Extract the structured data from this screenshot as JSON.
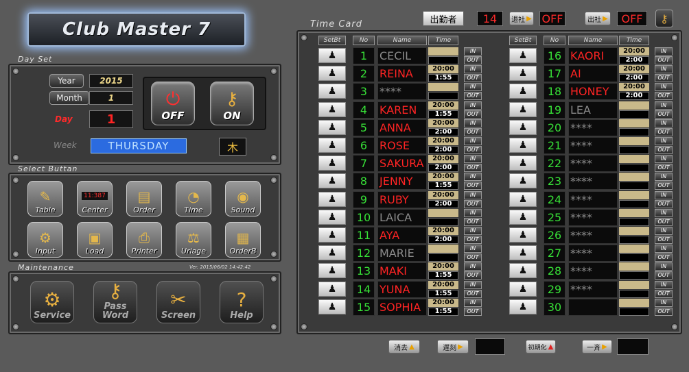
{
  "app": {
    "title": "Club Master 7",
    "version": "Ver. 2015/06/02 14:42:42"
  },
  "sections": {
    "day_set": "Day Set",
    "select_button": "Select Buttan",
    "maintenance": "Maintenance",
    "time_card": "Time Card"
  },
  "day_set": {
    "year_label": "Year",
    "year_value": "2015",
    "month_label": "Month",
    "month_value": "1",
    "day_label": "Day",
    "day_value": "1",
    "week_label": "Week",
    "week_value": "THURSDAY",
    "week_kanji": "木",
    "off_label": "OFF",
    "on_label": "ON"
  },
  "select_buttons": [
    {
      "label": "Table",
      "icon": "✎"
    },
    {
      "label": "Center",
      "icon": "▭"
    },
    {
      "label": "Order",
      "icon": "▤"
    },
    {
      "label": "Time",
      "icon": "◔"
    },
    {
      "label": "Sound",
      "icon": "◉"
    },
    {
      "label": "Input",
      "icon": "⚙"
    },
    {
      "label": "Load",
      "icon": "▣"
    },
    {
      "label": "Printer",
      "icon": "⎙"
    },
    {
      "label": "Uriage",
      "icon": "⚖"
    },
    {
      "label": "OrderB",
      "icon": "▦"
    }
  ],
  "center_display": "11:387",
  "maintenance": [
    {
      "label": "Service",
      "icon": "⚙"
    },
    {
      "label": "Pass\nWord",
      "icon": "⚷"
    },
    {
      "label": "Screen",
      "icon": "✂"
    },
    {
      "label": "Help",
      "icon": "?"
    }
  ],
  "topbar": {
    "attendance_label": "出勤者",
    "attendance_count": "14",
    "leave_label": "退社",
    "leave_state": "OFF",
    "arrive_label": "出社",
    "arrive_state": "OFF"
  },
  "headers": {
    "setbt": "SetBt",
    "no": "No",
    "name": "Name",
    "time": "Time"
  },
  "in_label": "IN",
  "out_label": "OUT",
  "left_column": [
    {
      "no": "1",
      "name": "CECIL",
      "active": false,
      "in": "",
      "out": ""
    },
    {
      "no": "2",
      "name": "REINA",
      "active": true,
      "in": "20:00",
      "out": "1:55"
    },
    {
      "no": "3",
      "name": "****",
      "active": false,
      "in": "",
      "out": ""
    },
    {
      "no": "4",
      "name": "KAREN",
      "active": true,
      "in": "20:00",
      "out": "1:55"
    },
    {
      "no": "5",
      "name": "ANNA",
      "active": true,
      "in": "20:00",
      "out": "2:00"
    },
    {
      "no": "6",
      "name": "ROSE",
      "active": true,
      "in": "20:00",
      "out": "2:00"
    },
    {
      "no": "7",
      "name": "SAKURA",
      "active": true,
      "in": "20:00",
      "out": "2:00"
    },
    {
      "no": "8",
      "name": "JENNY",
      "active": true,
      "in": "20:00",
      "out": "1:55"
    },
    {
      "no": "9",
      "name": "RUBY",
      "active": true,
      "in": "20:00",
      "out": "2:00"
    },
    {
      "no": "10",
      "name": "LAICA",
      "active": false,
      "in": "",
      "out": ""
    },
    {
      "no": "11",
      "name": "AYA",
      "active": true,
      "in": "20:00",
      "out": "2:00"
    },
    {
      "no": "12",
      "name": "MARIE",
      "active": false,
      "in": "",
      "out": ""
    },
    {
      "no": "13",
      "name": "MAKI",
      "active": true,
      "in": "20:00",
      "out": "1:55"
    },
    {
      "no": "14",
      "name": "YUNA",
      "active": true,
      "in": "20:00",
      "out": "1:55"
    },
    {
      "no": "15",
      "name": "SOPHIA",
      "active": true,
      "in": "20:00",
      "out": "1:55"
    }
  ],
  "right_column": [
    {
      "no": "16",
      "name": "KAORI",
      "active": true,
      "in": "20:00",
      "out": "2:00"
    },
    {
      "no": "17",
      "name": "AI",
      "active": true,
      "in": "20:00",
      "out": "2:00"
    },
    {
      "no": "18",
      "name": "HONEY",
      "active": true,
      "in": "20:00",
      "out": "2:00"
    },
    {
      "no": "19",
      "name": "LEA",
      "active": false,
      "in": "",
      "out": ""
    },
    {
      "no": "20",
      "name": "****",
      "active": false,
      "in": "",
      "out": ""
    },
    {
      "no": "21",
      "name": "****",
      "active": false,
      "in": "",
      "out": ""
    },
    {
      "no": "22",
      "name": "****",
      "active": false,
      "in": "",
      "out": ""
    },
    {
      "no": "23",
      "name": "****",
      "active": false,
      "in": "",
      "out": ""
    },
    {
      "no": "24",
      "name": "****",
      "active": false,
      "in": "",
      "out": ""
    },
    {
      "no": "25",
      "name": "****",
      "active": false,
      "in": "",
      "out": ""
    },
    {
      "no": "26",
      "name": "****",
      "active": false,
      "in": "",
      "out": ""
    },
    {
      "no": "27",
      "name": "****",
      "active": false,
      "in": "",
      "out": ""
    },
    {
      "no": "28",
      "name": "****",
      "active": false,
      "in": "",
      "out": ""
    },
    {
      "no": "29",
      "name": "****",
      "active": false,
      "in": "",
      "out": ""
    },
    {
      "no": "30",
      "name": "",
      "active": false,
      "in": "",
      "out": ""
    }
  ],
  "bottombar": {
    "clear_label": "消去",
    "late_label": "遅刻",
    "init_label": "初期化",
    "all_label": "一斉"
  },
  "colors": {
    "active_name": "#ff2424",
    "inactive_name": "#8a8a8a",
    "number": "#37e037",
    "time_in_bg": "#c9b98a",
    "off_red": "#ff2a2a",
    "accent_gold": "#e8a000"
  }
}
